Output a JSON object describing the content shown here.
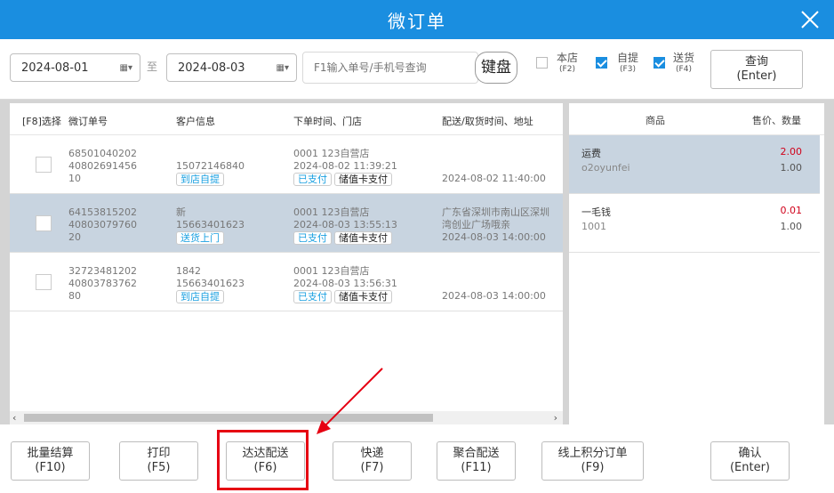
{
  "window": {
    "title": "微订单"
  },
  "filters": {
    "date_from": "2024-08-01",
    "date_sep": "至",
    "date_to": "2024-08-03",
    "search_placeholder": "F1输入单号/手机号查询",
    "keyboard_label": "键盘",
    "checks": [
      {
        "label": "本店",
        "key": "(F2)",
        "checked": false
      },
      {
        "label": "自提",
        "key": "(F3)",
        "checked": true
      },
      {
        "label": "送货",
        "key": "(F4)",
        "checked": true
      }
    ],
    "query_label": "查询",
    "query_key": "(Enter)"
  },
  "orders": {
    "headers": [
      "[F8]选择",
      "微订单号",
      "客户信息",
      "下单时间、门店",
      "配送/取货时间、地址"
    ],
    "rows": [
      {
        "order_no": [
          "68501040202",
          "40802691456",
          "10"
        ],
        "customer": [
          "",
          "15072146840"
        ],
        "type": "到店自提",
        "store": "0001 123自营店",
        "time": "2024-08-02 11:39:21",
        "pay_status": "已支付",
        "pay_method": "储值卡支付",
        "addr": [
          "",
          "",
          "2024-08-02 11:40:00"
        ],
        "selected": false
      },
      {
        "order_no": [
          "64153815202",
          "40803079760",
          "20"
        ],
        "customer": [
          "新",
          "15663401623"
        ],
        "type": "送货上门",
        "store": "0001 123自营店",
        "time": "2024-08-03 13:55:13",
        "pay_status": "已支付",
        "pay_method": "储值卡支付",
        "addr": [
          "广东省深圳市南山区深圳",
          "湾创业广场哦亲",
          "2024-08-03 14:00:00"
        ],
        "selected": true
      },
      {
        "order_no": [
          "32723481202",
          "40803783762",
          "80"
        ],
        "customer": [
          "1842",
          "15663401623"
        ],
        "type": "到店自提",
        "store": "0001 123自营店",
        "time": "2024-08-03 13:56:31",
        "pay_status": "已支付",
        "pay_method": "储值卡支付",
        "addr": [
          "",
          "",
          "2024-08-03 14:00:00"
        ],
        "selected": false
      }
    ]
  },
  "goods": {
    "headers": [
      "商品",
      "售价、数量"
    ],
    "items": [
      {
        "name": "运费",
        "code": "o2oyunfei",
        "price": "2.00",
        "qty": "1.00",
        "selected": true
      },
      {
        "name": "一毛钱",
        "code": "1001",
        "price": "0.01",
        "qty": "1.00",
        "selected": false
      }
    ]
  },
  "actions": [
    {
      "label": "批量结算",
      "key": "(F10)"
    },
    {
      "label": "打印",
      "key": "(F5)"
    },
    {
      "label": "达达配送",
      "key": "(F6)"
    },
    {
      "label": "快递",
      "key": "(F7)"
    },
    {
      "label": "聚合配送",
      "key": "(F11)"
    },
    {
      "label": "线上积分订单",
      "key": "(F9)"
    },
    {
      "label": "确认",
      "key": "(Enter)"
    }
  ],
  "colors": {
    "accent": "#1a8ee0",
    "highlight": "#e60012",
    "price": "#d0021b",
    "selected_row": "#c8d4e0"
  }
}
